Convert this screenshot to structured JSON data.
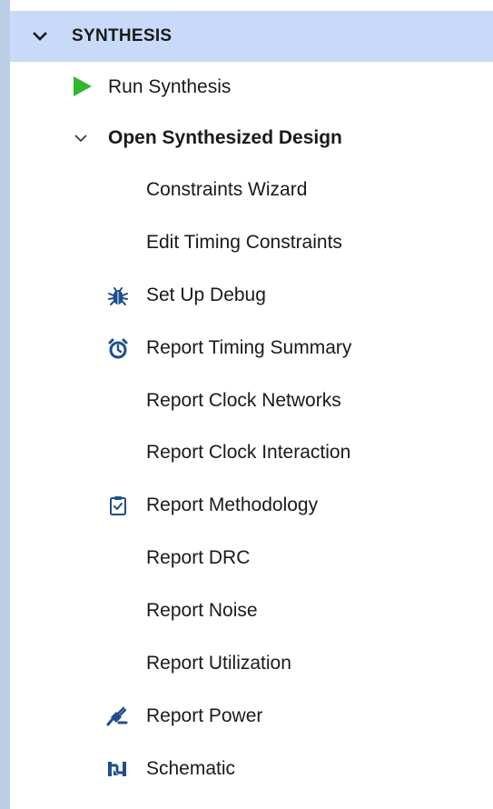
{
  "section": {
    "title": "SYNTHESIS",
    "items": [
      {
        "label": "Run Synthesis",
        "icon": "play-icon"
      },
      {
        "label": "Open Synthesized Design",
        "icon": "chevron-down-icon"
      },
      {
        "label": "Constraints Wizard"
      },
      {
        "label": "Edit Timing Constraints"
      },
      {
        "label": "Set Up Debug",
        "icon": "bug-icon"
      },
      {
        "label": "Report Timing Summary",
        "icon": "stopwatch-icon"
      },
      {
        "label": "Report Clock Networks"
      },
      {
        "label": "Report Clock Interaction"
      },
      {
        "label": "Report Methodology",
        "icon": "clipboard-check-icon"
      },
      {
        "label": "Report DRC"
      },
      {
        "label": "Report Noise"
      },
      {
        "label": "Report Utilization"
      },
      {
        "label": "Report Power",
        "icon": "power-plug-icon"
      },
      {
        "label": "Schematic",
        "icon": "schematic-icon"
      }
    ]
  },
  "colors": {
    "header_bg": "#c9daf8",
    "left_strip": "#bccde6",
    "play_green": "#2fb82f",
    "icon_blue": "#1f4e8c"
  }
}
